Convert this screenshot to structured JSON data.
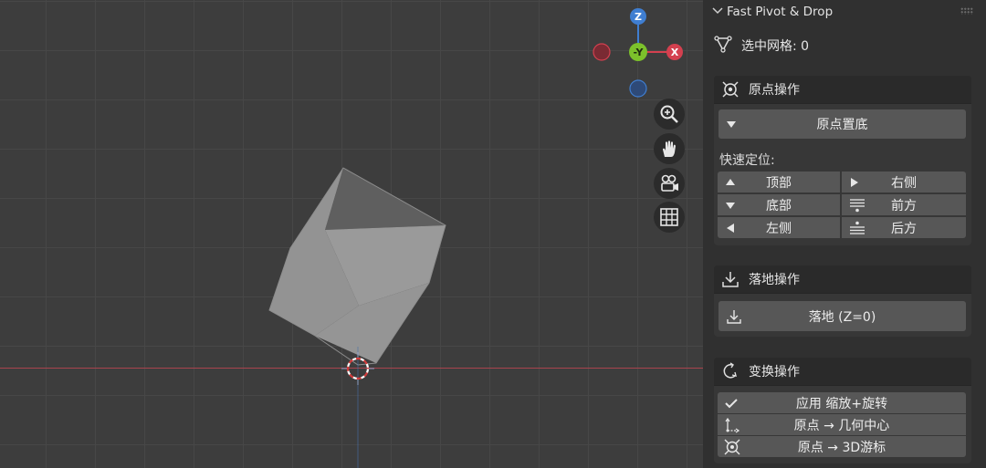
{
  "viewport": {
    "nav_icons": [
      "zoom-icon",
      "pan-hand-icon",
      "camera-view-icon",
      "ortho-grid-icon"
    ],
    "gizmo": {
      "z_label": "Z",
      "y_label": "-Y",
      "x_label": "X"
    },
    "colors": {
      "x": "#d4404f",
      "y": "#7cc12b",
      "z": "#3f7ed1",
      "grid": "#474747",
      "background": "#3d3d3d"
    }
  },
  "sidebar": {
    "panel_title": "Fast Pivot & Drop",
    "mesh_label": "选中网格: 0",
    "origin_section": {
      "title": "原点操作",
      "to_bottom_button": "原点置底",
      "quick_label": "快速定位:",
      "grid_buttons": [
        {
          "label": "顶部",
          "icon": "triangle-up-icon"
        },
        {
          "label": "右侧",
          "icon": "triangle-right-icon"
        },
        {
          "label": "底部",
          "icon": "triangle-down-icon"
        },
        {
          "label": "前方",
          "icon": "front-lines-icon"
        },
        {
          "label": "左侧",
          "icon": "triangle-left-icon"
        },
        {
          "label": "后方",
          "icon": "back-lines-icon"
        }
      ]
    },
    "drop_section": {
      "title": "落地操作",
      "drop_button": "落地 (Z=0)"
    },
    "transform_section": {
      "title": "变换操作",
      "buttons": [
        {
          "label": "应用 缩放+旋转",
          "icon": "checkmark-icon"
        },
        {
          "label": "原点 → 几何中心",
          "icon": "axes-icon"
        },
        {
          "label": "原点 → 3D游标",
          "icon": "origin-icon"
        }
      ]
    }
  }
}
